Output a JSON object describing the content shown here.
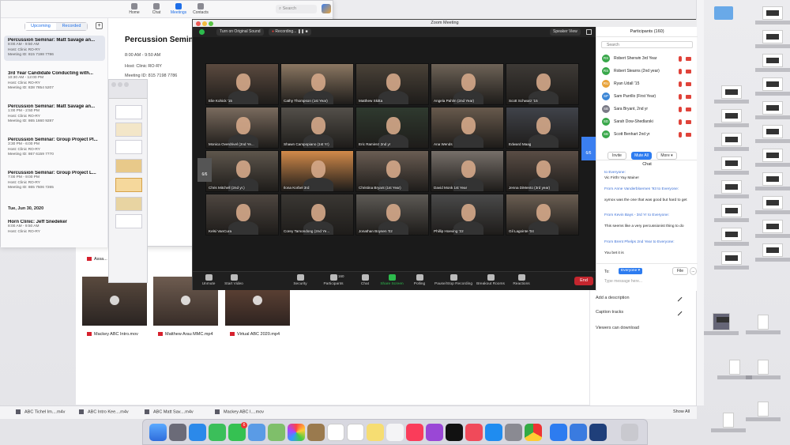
{
  "calendar": {
    "nav": [
      "Home",
      "Chat",
      "Meetings",
      "Contacts"
    ],
    "search_placeholder": "Search",
    "tabs": [
      "Upcoming",
      "Recorded"
    ],
    "meetings": [
      {
        "title": "Percussion Seminar: Matt Savage an...",
        "time": "8:00 AM - 9:50 AM",
        "host": "Host: Clinic RO-RY",
        "id": "Meeting ID: 815 7198 7786"
      },
      {
        "title": "3rd Year Candidate Conducting with...",
        "time": "10:30 AM - 12:00 PM",
        "host": "Host: Clinic RO-RY",
        "id": "Meeting ID: 838 7854 5207"
      },
      {
        "title": "Percussion Seminar: Matt Savage an...",
        "time": "1:00 PM - 2:50 PM",
        "host": "Host: Clinic RO-RY",
        "id": "Meeting ID: 865 1660 9287"
      },
      {
        "title": "Percussion Seminar: Group Project Pl...",
        "time": "3:30 PM - 6:00 PM",
        "host": "Host: Clinic RO-RY",
        "id": "Meeting ID: 867 6159 7770"
      },
      {
        "title": "Percussion Seminar: Group Project L...",
        "time": "7:00 PM - 9:00 PM",
        "host": "Host: Clinic RO-RY",
        "id": "Meeting ID: 865 7506 7265"
      }
    ],
    "date_header": "Tue, Jun 30, 2020",
    "meeting_next": {
      "title": "Horn Clinic: Jeff Snedeker",
      "time": "8:00 AM - 9:50 AM",
      "host": "Host: Clinic RO-RY"
    },
    "detail": {
      "title": "Percussion Seminar",
      "time": "8:00 AM - 9:50 AM",
      "host": "Host: Clinic RO-RY",
      "id": "Meeting ID: 815 7198 7786"
    }
  },
  "files": {
    "row1": [
      "Assa..."
    ],
    "videos": [
      {
        "name": "Mackey ABC Intro.mov"
      },
      {
        "name": "Matthew Arau MMC.mp4"
      },
      {
        "name": "Virtual ABC 2020.mp4"
      }
    ]
  },
  "side_panel": {
    "add_description": "Add a description",
    "caption_tracks": "Caption tracks",
    "viewers": "Viewers can download"
  },
  "downloads": {
    "items": [
      "ABC Tichel Im....m4v",
      "ABC Intro Kee....m4v",
      "ABC Matt Sav....m4v",
      "Mackey ABC I....mov"
    ],
    "show_all": "Show All"
  },
  "zoom": {
    "title": "Zoom Meeting",
    "original_sound": "Turn on Original Sound",
    "recording": "Recording...",
    "speaker_view": "Speaker View",
    "page_left": "6/6",
    "page_right": "6/6",
    "participants_video": [
      "Elie Kohick '15",
      "Cathy Thompson (1st Year)",
      "Matthew Skitta",
      "Angela Pahlm (2nd Year)",
      "Scott Schwarz '15",
      "Monica Overdrivel (2nd Ye...",
      "Shawn Campopiano (1st Yr)",
      "Eric Ramirez 2nd yr",
      "Ana Wends",
      "Edward Maag",
      "Chris Mitchell (2nd yr.)",
      "Ilona Korbel 3rd",
      "Christina Bryant (1st Year)",
      "David Monk 1st Year",
      "Jenna DiMento (3rd year)",
      "Kelsi VanCura",
      "Corey Tamondong (2nd Ye...",
      "Jonathan Boysen '02",
      "Phillip Hoeving '22",
      "Gil Lagointe '04"
    ],
    "toolbar": [
      "Unmute",
      "Start Video",
      "Security",
      "Participants",
      "Chat",
      "Share Screen",
      "Polling",
      "Pause/Stop Recording",
      "Breakout Rooms",
      "Reactions"
    ],
    "participant_count": "160",
    "end": "End"
  },
  "participants": {
    "header": "Participants (160)",
    "search_placeholder": "Search",
    "list": [
      {
        "name": "Robert Sherwin 3rd Year",
        "initials": "RS",
        "color": "#39a74a"
      },
      {
        "name": "Robert Stearns (2nd year)",
        "initials": "RS",
        "color": "#39a74a"
      },
      {
        "name": "Ryan Udall '15",
        "initials": "RU",
        "color": "#e8a33a"
      },
      {
        "name": "Sam Parrillo (First Year)",
        "initials": "SP",
        "color": "#3b86d6"
      },
      {
        "name": "Sara Bryant, 2nd yr",
        "initials": "SB",
        "color": "#7a7a86"
      },
      {
        "name": "Sarah Dow-Shedlarski",
        "initials": "SD",
        "color": "#39a74a"
      },
      {
        "name": "Scott Benhart 2nd yr",
        "initials": "SB",
        "color": "#39a74a"
      }
    ],
    "invite": "Invite",
    "mute_all": "Mute All",
    "more": "More"
  },
  "chat": {
    "header": "Chat",
    "messages": [
      {
        "meta": "to Everyone:",
        "text": "Vic Firth!  Yay Maine!"
      },
      {
        "meta": "From Anne Vanderbloemen '93 to Everyone:",
        "text": "xymox was the one that was good but hard to get"
      },
      {
        "meta": "From Kevin Bays - 3rd Yr to Everyone:",
        "text": "This seems like a very percussionist thing to do"
      },
      {
        "meta": "From Brent Phelps 2nd Year to Everyone:",
        "text": "You bet it is"
      }
    ],
    "to_label": "To:",
    "to_value": "Everyone",
    "file": "File",
    "more": "...",
    "input_placeholder": "Type message here..."
  },
  "colors": {
    "accent": "#1f6fe8",
    "zoom_blue": "#2d7cf0",
    "end_red": "#c4262e",
    "share_green": "#2dbb4d"
  }
}
